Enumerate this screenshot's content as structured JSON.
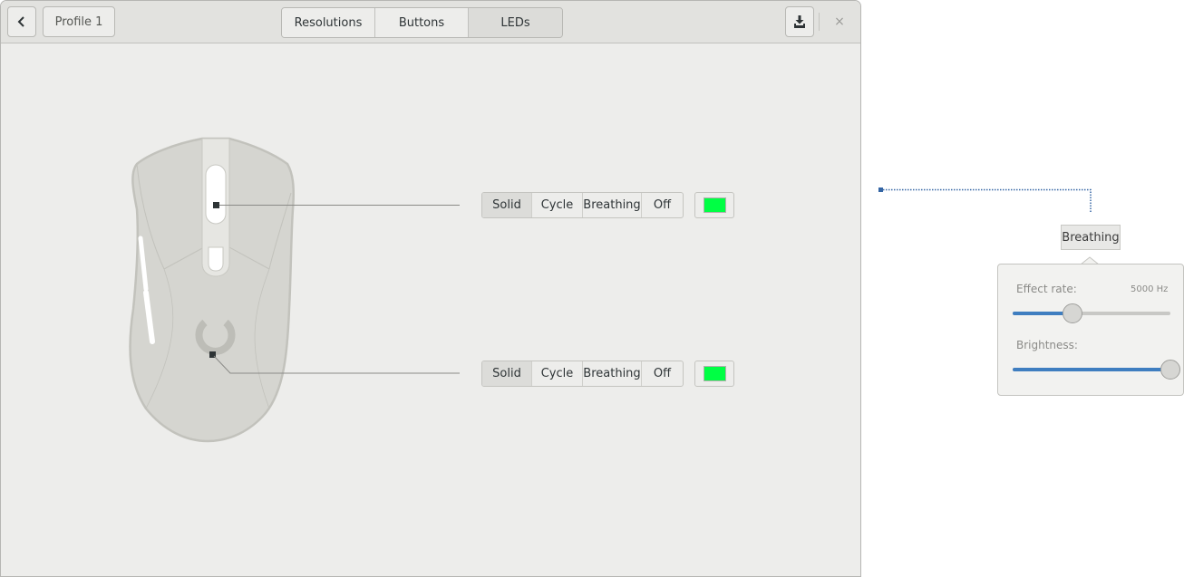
{
  "headerbar": {
    "back_icon": "chevron-left-icon",
    "profile_label": "Profile 1",
    "tabs": [
      {
        "label": "Resolutions",
        "active": false
      },
      {
        "label": "Buttons",
        "active": false
      },
      {
        "label": "LEDs",
        "active": true
      }
    ],
    "save_icon": "download-save-icon",
    "close_label": "×"
  },
  "leds": [
    {
      "name": "logo-led-top",
      "modes": [
        "Solid",
        "Cycle",
        "Breathing",
        "Off"
      ],
      "active_mode": "Solid",
      "color": "#00ff44"
    },
    {
      "name": "logo-led-bottom",
      "modes": [
        "Solid",
        "Cycle",
        "Breathing",
        "Off"
      ],
      "active_mode": "Solid",
      "color": "#00ff44"
    }
  ],
  "annotation": {
    "label": "Breathing",
    "line_color": "#3465a4"
  },
  "popover": {
    "effect_rate_label": "Effect rate:",
    "effect_rate_value": "5000 Hz",
    "effect_rate_fraction": 0.38,
    "brightness_label": "Brightness:",
    "brightness_fraction": 1.0,
    "accent_color": "#3f7ec0"
  }
}
